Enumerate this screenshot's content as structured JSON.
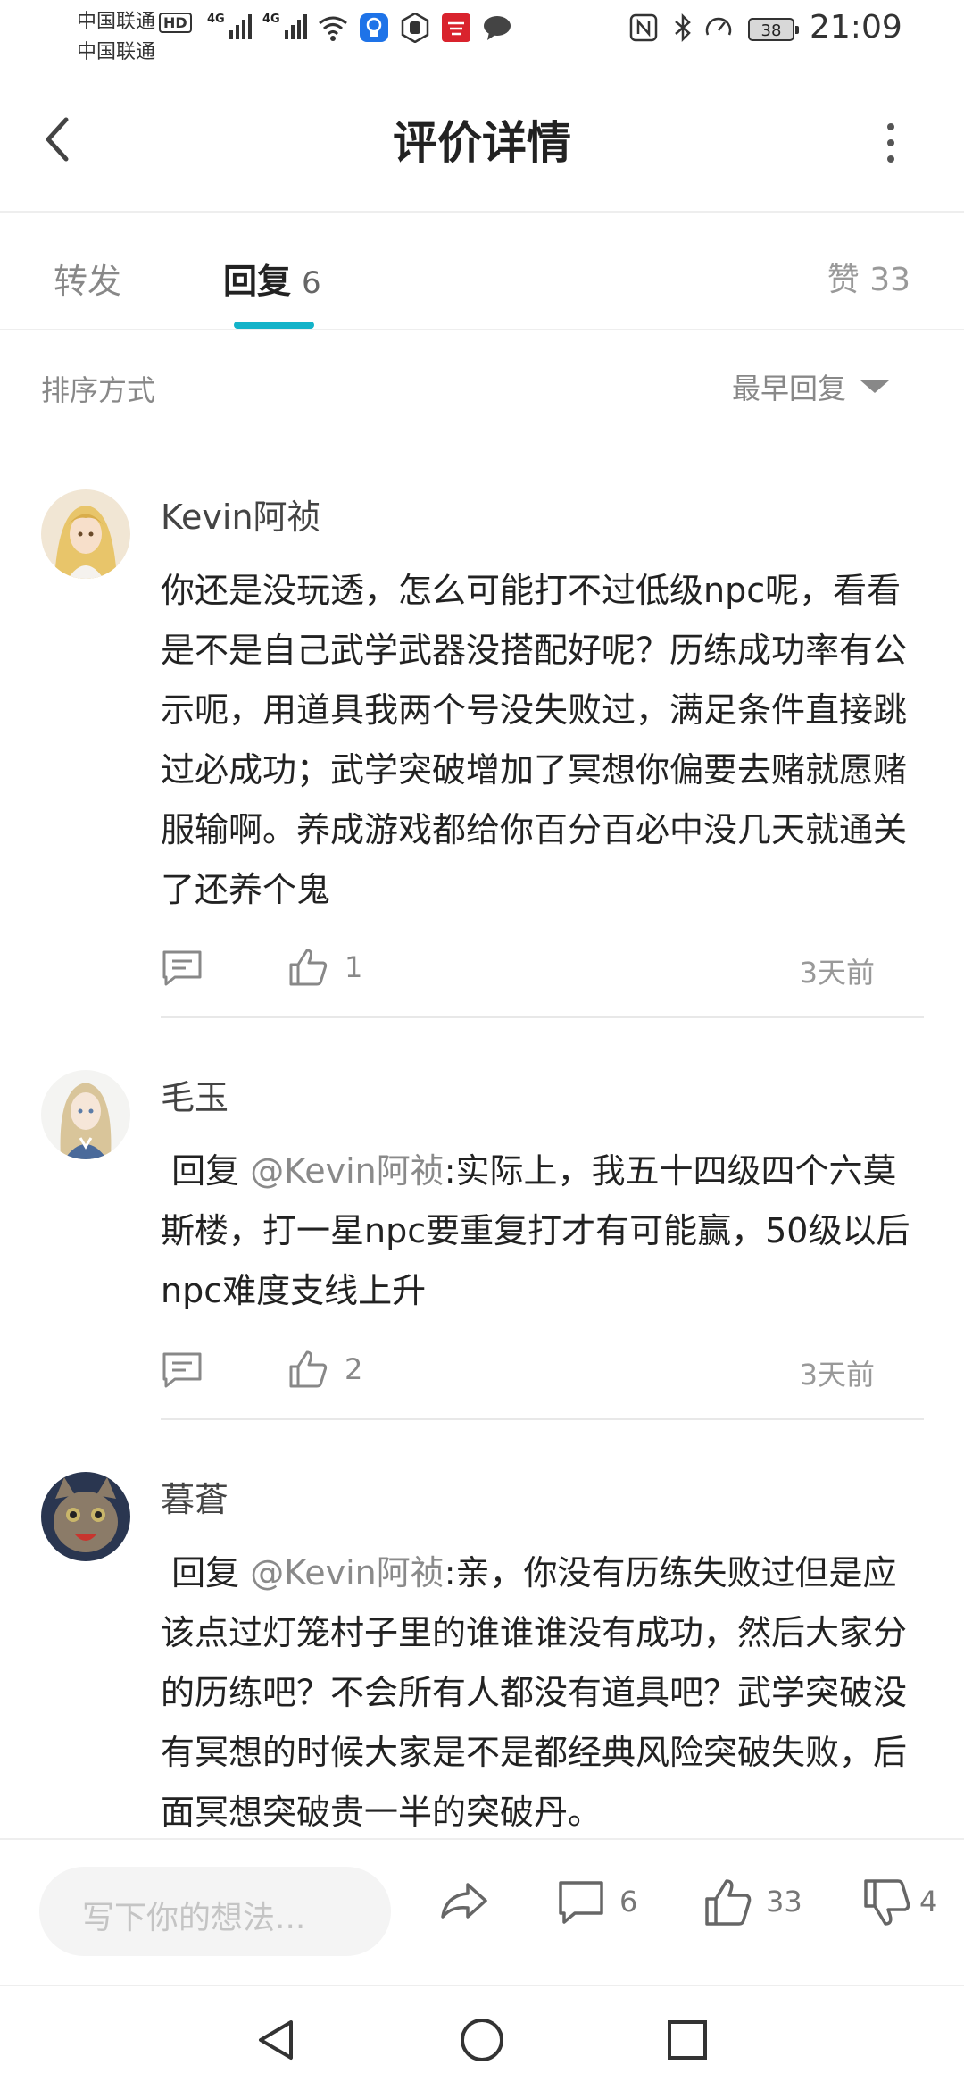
{
  "status_bar": {
    "carrier1": "中国联通",
    "carrier1_badge": "HD",
    "carrier2": "中国联通",
    "signal1_label": "4G",
    "signal2_label": "4G",
    "battery": "38",
    "time": "21:09"
  },
  "header": {
    "title": "评价详情"
  },
  "tabs": {
    "forward": "转发",
    "reply": "回复",
    "reply_count": "6",
    "like_label": "赞",
    "like_count": "33"
  },
  "sort": {
    "label": "排序方式",
    "value": "最早回复"
  },
  "comments": [
    {
      "user": "Kevin阿祯",
      "text": "你还是没玩透，怎么可能打不过低级npc呢，看看是不是自己武学武器没搭配好呢？历练成功率有公示呃，用道具我两个号没失败过，满足条件直接跳过必成功；武学突破增加了冥想你偏要去赌就愿赌服输啊。养成游戏都给你百分百必中没几天就通关了还养个鬼",
      "likes": "1",
      "time": "3天前"
    },
    {
      "user": "毛玉",
      "reply_prefix": "回复",
      "mention": "@Kevin阿祯",
      "text": ":实际上，我五十四级四个六莫斯楼，打一星npc要重复打才有可能赢，50级以后npc难度支线上升",
      "likes": "2",
      "time": "3天前"
    },
    {
      "user": "暮蒼",
      "reply_prefix": "回复",
      "mention": "@Kevin阿祯",
      "text": ":亲，你没有历练失败过但是应该点过灯笼村子里的谁谁谁没有成功，然后大家分的历练吧？不会所有人都没有道具吧？武学突破没有冥想的时候大家是不是都经典风险突破失败，后面冥想突破贵一半的突破丹。"
    }
  ],
  "bottom_bar": {
    "input_placeholder": "写下你的想法...",
    "comment_count": "6",
    "like_count": "33",
    "dislike_count": "4"
  },
  "colors": {
    "accent": "#13b3c9",
    "text_primary": "#222222",
    "text_secondary": "#888888"
  }
}
